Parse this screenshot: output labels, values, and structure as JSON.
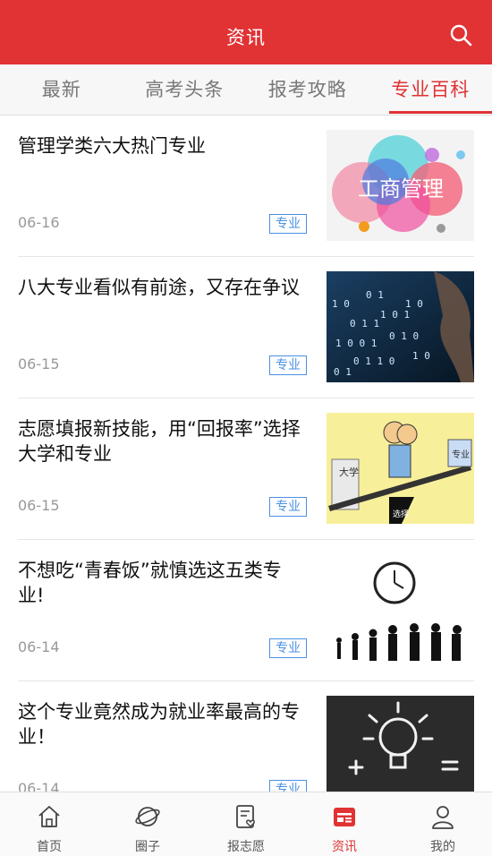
{
  "header": {
    "title": "资讯",
    "search_icon": "search-icon"
  },
  "tabs": [
    {
      "label": "最新",
      "active": false
    },
    {
      "label": "高考头条",
      "active": false
    },
    {
      "label": "报考攻略",
      "active": false
    },
    {
      "label": "专业百科",
      "active": true
    }
  ],
  "articles": [
    {
      "title": "管理学类六大热门专业",
      "date": "06-16",
      "tag": "专业",
      "image_text": "工商管理"
    },
    {
      "title": "八大专业看似有前途，又存在争议",
      "date": "06-15",
      "tag": "专业"
    },
    {
      "title": "志愿填报新技能，用“回报率”选择大学和专业",
      "date": "06-15",
      "tag": "专业",
      "image_labels": [
        "大学",
        "专业",
        "选择"
      ]
    },
    {
      "title": "不想吃“青春饭”就慎选这五类专业!",
      "date": "06-14",
      "tag": "专业"
    },
    {
      "title": "这个专业竟然成为就业率最高的专业！",
      "date": "06-14",
      "tag": "专业"
    }
  ],
  "tabbar": [
    {
      "label": "首页",
      "icon": "home-icon",
      "active": false
    },
    {
      "label": "圈子",
      "icon": "planet-icon",
      "active": false
    },
    {
      "label": "报志愿",
      "icon": "form-heart-icon",
      "active": false
    },
    {
      "label": "资讯",
      "icon": "news-icon",
      "active": true
    },
    {
      "label": "我的",
      "icon": "user-icon",
      "active": false
    }
  ],
  "colors": {
    "brand": "#e13234",
    "tag": "#4a90e2",
    "muted": "#999999"
  }
}
